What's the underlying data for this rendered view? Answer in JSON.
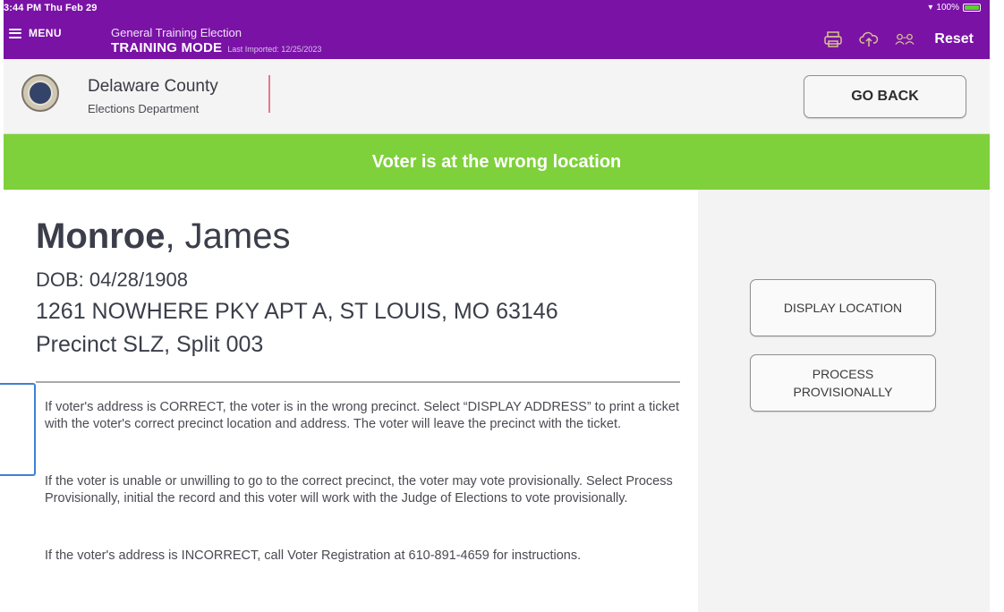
{
  "status_bar": {
    "time": "3:44 PM  Thu Feb 29",
    "battery": "100%"
  },
  "nav": {
    "menu_label": "MENU",
    "election_name": "General Training Election",
    "training_mode": "TRAINING MODE",
    "last_imported": "Last Imported: 12/25/2023",
    "reset_label": "Reset"
  },
  "header": {
    "org_name": "Delaware County",
    "org_dept": "Elections Department",
    "go_back_label": "GO BACK"
  },
  "banner": {
    "message": "Voter is at the wrong location"
  },
  "voter": {
    "last_name": "Monroe",
    "first_name": ", James",
    "dob": "DOB: 04/28/1908",
    "address": "1261 NOWHERE PKY APT A, ST LOUIS, MO 63146",
    "precinct": "Precinct SLZ, Split 003"
  },
  "instructions": [
    "If voter's address is CORRECT, the voter is in the wrong precinct. Select “DISPLAY ADDRESS” to print a ticket with the voter's correct precinct location and address. The voter will leave the precinct with the ticket.",
    "If the voter is unable or unwilling to go to the correct precinct, the voter may vote provisionally.  Select Process Provisionally, initial the record and this voter will work with the Judge of Elections to vote provisionally.",
    "If the voter's address is INCORRECT, call Voter Registration at 610-891-4659 for instructions."
  ],
  "actions": {
    "display_location": "DISPLAY LOCATION",
    "process_provisionally": "PROCESS PROVISIONALLY"
  },
  "colors": {
    "nav_bg": "#7a12a6",
    "banner_bg": "#7ed13a",
    "highlight": "#3f7fd6"
  }
}
